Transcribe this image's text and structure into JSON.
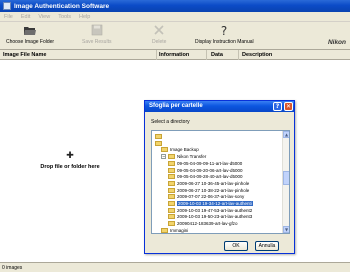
{
  "window": {
    "title": "Image Authentication Software"
  },
  "menu": [
    "File",
    "Edit",
    "View",
    "Tools",
    "Help"
  ],
  "toolbar": {
    "choose_folder": "Choose Image Folder",
    "save_results": "Save Results",
    "delete": "Delete",
    "display_manual": "Display Instruction Manual",
    "brand": "Nikon"
  },
  "columns": {
    "file_name": "Image File Name",
    "information": "Information",
    "data": "Data",
    "description": "Description"
  },
  "drop_area": {
    "text": "Drop file or folder here"
  },
  "status": {
    "count": "0 images"
  },
  "dialog": {
    "title": "Sfoglia per cartelle",
    "label": "Select a directory",
    "help": "?",
    "close": "✕",
    "ok": "OK",
    "cancel": "Annulla",
    "tree": [
      {
        "label": "",
        "level": 1
      },
      {
        "label": "",
        "level": 1
      },
      {
        "label": "Image Backup",
        "level": 2
      },
      {
        "label": "Nikon Transfer",
        "level": 2,
        "expanded": true
      },
      {
        "label": "09-05-04-09-09-11-art-lav-d5000",
        "level": 3
      },
      {
        "label": "09-05-04-09-20-06-art-lav-d5000",
        "level": 3
      },
      {
        "label": "09-05-04-09-28-40-art-lav-d5000",
        "level": 3
      },
      {
        "label": "2009-06-27 10-36-45-art-lav-pinhole",
        "level": 3
      },
      {
        "label": "2009-06-27 10-38-22-art-lav-pinhole",
        "level": 3
      },
      {
        "label": "2009-07-07 22-06-37-art-lav-sony",
        "level": 3
      },
      {
        "label": "2009-10-03 19-34-12-art-lav-authenti",
        "level": 3,
        "selected": true
      },
      {
        "label": "2009-10-03 19-47-53-art-lav-authent2",
        "level": 3
      },
      {
        "label": "2009-10-03 19-50-23-art-lav-authent3",
        "level": 3
      },
      {
        "label": "20090412-183639-art-lav-gfzo",
        "level": 3
      },
      {
        "label": "Immagini",
        "level": 2
      }
    ]
  }
}
